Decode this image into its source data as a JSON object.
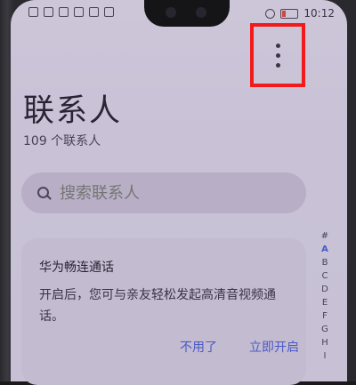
{
  "status_bar": {
    "time": "10:12"
  },
  "header": {
    "title": "联系人",
    "subtitle": "109 个联系人"
  },
  "search": {
    "placeholder": "搜索联系人"
  },
  "card": {
    "title": "华为畅连通话",
    "body": "开启后，您可与亲友轻松发起高清音视频通话。",
    "dismiss_label": "不用了",
    "enable_label": "立即开启"
  },
  "alpha_index": [
    "#",
    "A",
    "B",
    "C",
    "D",
    "E",
    "F",
    "G",
    "H",
    "I"
  ],
  "colors": {
    "accent": "#4a59c9",
    "highlight": "#f21a1a"
  }
}
